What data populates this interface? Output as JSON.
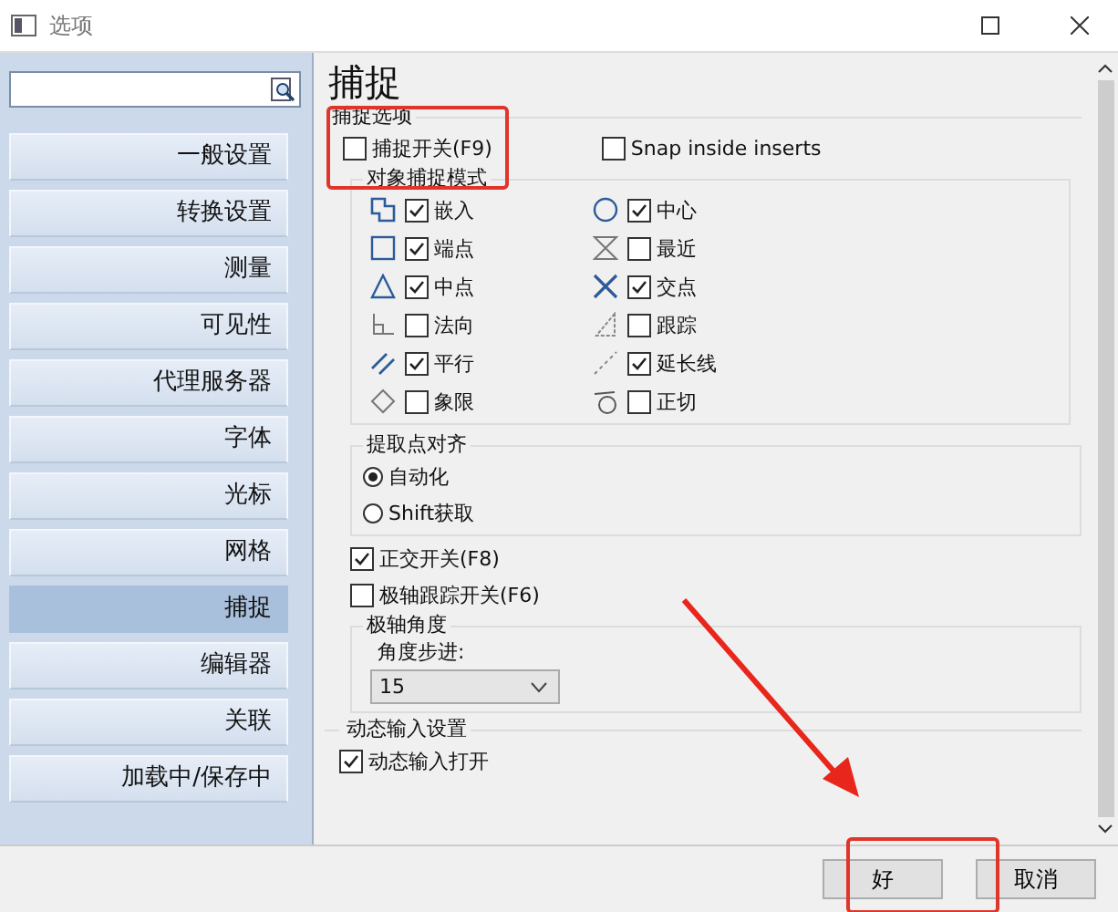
{
  "window": {
    "title": "选项"
  },
  "sidebar": {
    "items": [
      {
        "label": "一般设置",
        "selected": false
      },
      {
        "label": "转换设置",
        "selected": false
      },
      {
        "label": "测量",
        "selected": false
      },
      {
        "label": "可见性",
        "selected": false
      },
      {
        "label": "代理服务器",
        "selected": false
      },
      {
        "label": "字体",
        "selected": false
      },
      {
        "label": "光标",
        "selected": false
      },
      {
        "label": "网格",
        "selected": false
      },
      {
        "label": "捕捉",
        "selected": true
      },
      {
        "label": "编辑器",
        "selected": false
      },
      {
        "label": "关联",
        "selected": false
      },
      {
        "label": "加载中/保存中",
        "selected": false
      }
    ]
  },
  "page": {
    "title": "捕捉",
    "snap_options": {
      "title": "捕捉选项",
      "toggles": [
        {
          "label": "捕捉开关(F9)",
          "checked": false
        },
        {
          "label": "Snap inside inserts",
          "checked": false
        }
      ]
    },
    "object_snap": {
      "title": "对象捕捉模式",
      "modes": [
        {
          "kind": "insert",
          "label": "嵌入",
          "checked": true
        },
        {
          "kind": "center",
          "label": "中心",
          "checked": true
        },
        {
          "kind": "endpoint",
          "label": "端点",
          "checked": true
        },
        {
          "kind": "nearest",
          "label": "最近",
          "checked": false
        },
        {
          "kind": "midpoint",
          "label": "中点",
          "checked": true
        },
        {
          "kind": "intersection",
          "label": "交点",
          "checked": true
        },
        {
          "kind": "perpendicular",
          "label": "法向",
          "checked": false
        },
        {
          "kind": "tracking",
          "label": "跟踪",
          "checked": false
        },
        {
          "kind": "parallel",
          "label": "平行",
          "checked": true
        },
        {
          "kind": "extension",
          "label": "延长线",
          "checked": true
        },
        {
          "kind": "quadrant",
          "label": "象限",
          "checked": false
        },
        {
          "kind": "tangent",
          "label": "正切",
          "checked": false
        }
      ]
    },
    "pick_alignment": {
      "title": "提取点对齐",
      "options": [
        {
          "label": "自动化",
          "selected": true
        },
        {
          "label": "Shift获取",
          "selected": false
        }
      ]
    },
    "toggles": [
      {
        "label": "正交开关(F8)",
        "checked": true
      },
      {
        "label": "极轴跟踪开关(F6)",
        "checked": false
      }
    ],
    "polar_angle": {
      "title": "极轴角度",
      "label": "角度步进:",
      "value": "15"
    },
    "dynamic_input": {
      "title": "动态输入设置",
      "toggles": [
        {
          "label": "动态输入打开",
          "checked": true
        }
      ]
    }
  },
  "buttons": [
    {
      "label": "好"
    },
    {
      "label": "取消"
    }
  ]
}
